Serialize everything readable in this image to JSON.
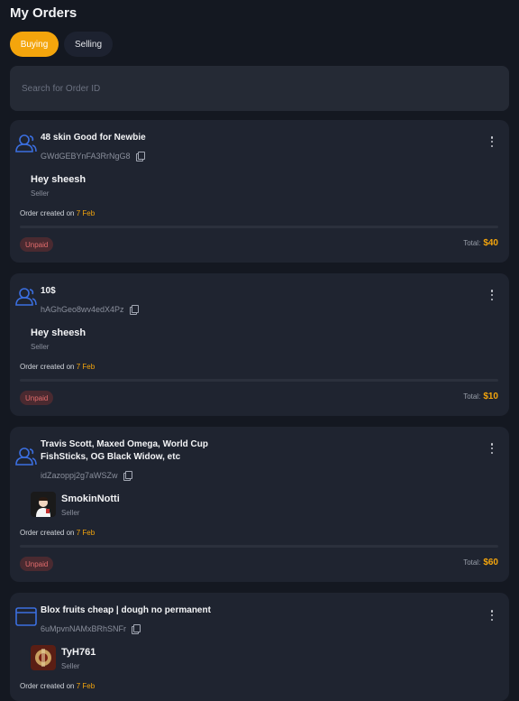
{
  "header": {
    "title": "My Orders"
  },
  "tabs": [
    {
      "label": "Buying",
      "active": true
    },
    {
      "label": "Selling",
      "active": false
    }
  ],
  "search": {
    "placeholder": "Search for Order ID"
  },
  "colors": {
    "accent": "#f4a50c",
    "unpaid_bg": "#4a2a30",
    "unpaid_text": "#e26c6c",
    "icon_blue": "#3b6fe0"
  },
  "orders": [
    {
      "icon": "user-group-icon",
      "title": "48 skin Good for Newbie",
      "order_id": "GWdGEBYnFA3RrNgG8",
      "seller_name": "Hey sheesh",
      "seller_role": "Seller",
      "created_label": "Order created on",
      "created_date": "7 Feb",
      "status": "Unpaid",
      "total_label": "Total:",
      "total": "$40"
    },
    {
      "icon": "user-group-icon",
      "title": "10$",
      "order_id": "hAGhGeo8wv4edX4Pz",
      "seller_name": "Hey sheesh",
      "seller_role": "Seller",
      "created_label": "Order created on",
      "created_date": "7 Feb",
      "status": "Unpaid",
      "total_label": "Total:",
      "total": "$10"
    },
    {
      "icon": "user-group-icon",
      "title": "Travis Scott, Maxed Omega, World Cup FishSticks, OG Black Widow, etc",
      "order_id": "idZazoppj2g7aWSZw",
      "seller_name": "SmokinNotti",
      "seller_role": "Seller",
      "created_label": "Order created on",
      "created_date": "7 Feb",
      "status": "Unpaid",
      "total_label": "Total:",
      "total": "$60"
    },
    {
      "icon": "box-icon",
      "title": "Blox fruits cheap | dough no permanent",
      "order_id": "6uMpvnNAMxBRhSNFr",
      "seller_name": "TyH761",
      "seller_role": "Seller",
      "created_label": "Order created on",
      "created_date": "7 Feb"
    }
  ]
}
